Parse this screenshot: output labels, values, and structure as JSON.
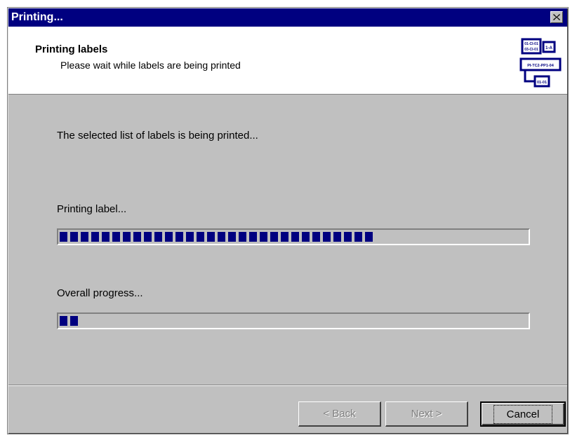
{
  "window": {
    "title": "Printing...",
    "close_icon": "close-x-icon"
  },
  "header": {
    "title": "Printing labels",
    "subtitle": "Please wait while labels are being printed",
    "logo_icon": "label-wizard-icon",
    "logo_text": [
      "01-CI-01",
      "03-CI-01",
      "1-A",
      "PI-TC2-PP1-04",
      "01-01"
    ]
  },
  "main": {
    "status_text": "The selected list of labels is being printed...",
    "label_progress": {
      "label": "Printing label...",
      "fraction": 0.68
    },
    "overall_progress": {
      "label": "Overall progress...",
      "fraction": 0.047
    }
  },
  "buttons": {
    "back_label": "< Back",
    "next_label": "Next >",
    "cancel_label": "Cancel"
  },
  "colors": {
    "titlebar": "#000080",
    "progress_fill": "#000080",
    "dialog_face": "#c0c0c0"
  }
}
